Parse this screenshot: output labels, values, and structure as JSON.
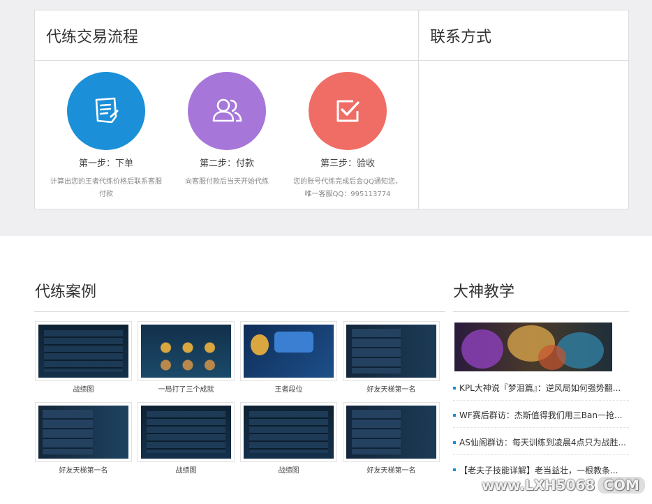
{
  "process": {
    "title": "代练交易流程",
    "steps": [
      {
        "title": "第一步：下单",
        "desc": "计算出您的王者代练价格后联系客服付款",
        "color": "#1b8fd8",
        "icon": "order-form-icon"
      },
      {
        "title": "第二步：付款",
        "desc": "向客服付款后当天开始代练",
        "color": "#a776d9",
        "icon": "users-icon"
      },
      {
        "title": "第三步：验收",
        "desc": "您的账号代练完成后会QQ通知您，唯一客服QQ：995113774",
        "color": "#f06d65",
        "icon": "check-box-icon"
      }
    ]
  },
  "contact": {
    "title": "联系方式"
  },
  "cases": {
    "title": "代练案例",
    "items": [
      {
        "caption": "战绩图"
      },
      {
        "caption": "一局打了三个成就"
      },
      {
        "caption": "王者段位"
      },
      {
        "caption": "好友天梯第一名"
      },
      {
        "caption": "好友天梯第一名"
      },
      {
        "caption": "战绩图"
      },
      {
        "caption": "战绩图"
      },
      {
        "caption": "好友天梯第一名"
      }
    ]
  },
  "guides": {
    "title": "大神教学",
    "news": [
      "KPL大神说『梦泪篇』：逆风局如何强势翻...",
      "WF赛后群访：杰斯值得我们用三Ban一抢...",
      "AS仙阁群访：每天训练到凌晨4点只为战胜...",
      "【老夫子技能详解】老当益壮，一根教条..."
    ]
  },
  "watermark": {
    "text": "www.LXH5068",
    "suffix": "COM"
  }
}
